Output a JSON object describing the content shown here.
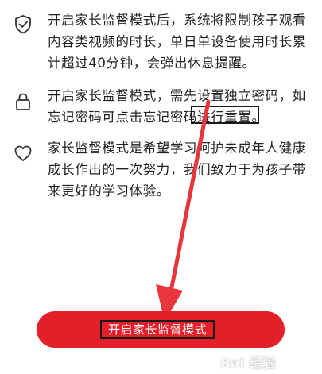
{
  "items": [
    {
      "icon": "shield-check-icon",
      "text": "开启家长监督模式后，系统将限制孩子观看\n内容类视频的时长，单日单设备使用时长累\n计超过40分钟，会弹出休息提醒。"
    },
    {
      "icon": "lock-icon",
      "text": "开启家长监督模式，需先设置独立密码，如\n忘记密码可点击忘记密码进行重置。"
    },
    {
      "icon": "heart-icon",
      "text": "家长监督模式是希望学习呵护未成年人健康\n成长作出的一次努力，我们致力于为孩子带\n来更好的学习体验。"
    }
  ],
  "cta": {
    "label": "开启家长监督模式"
  },
  "colors": {
    "accent": "#e3202a",
    "annotation": "#e8363c"
  },
  "watermark": {
    "text": "Bai 经验"
  }
}
